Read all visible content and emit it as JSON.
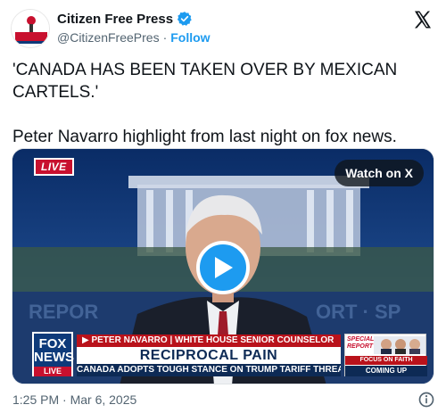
{
  "account": {
    "display_name": "Citizen Free Press",
    "handle": "@CitizenFreePres",
    "separator": "·",
    "follow_label": "Follow"
  },
  "tweet": {
    "text": "'CANADA HAS BEEN TAKEN OVER BY MEXICAN CARTELS.'\n\nPeter Navarro highlight from last night on fox news."
  },
  "media": {
    "live_badge": "LIVE",
    "watch_label": "Watch on X",
    "chyron": {
      "network": "FOX",
      "network_sub": "NEWS",
      "network_live": "LIVE",
      "nameplate": "▶ PETER NAVARRO | WHITE HOUSE SENIOR COUNSELOR",
      "headline": "RECIPROCAL PAIN",
      "subline": "CANADA ADOPTS TOUGH STANCE ON TRUMP TARIFF THREATS",
      "special_report": "SPECIAL REPORT",
      "focus": "FOCUS ON FAITH",
      "coming_up": "COMING UP"
    }
  },
  "footer": {
    "timestamp": "1:25 PM · Mar 6, 2025"
  },
  "colors": {
    "link_blue": "#1d9bf0",
    "text_primary": "#0f1419",
    "text_secondary": "#536471",
    "fox_red": "#b9121b",
    "fox_navy": "#0d2a55"
  },
  "icons": {
    "verified": "verified-badge-icon",
    "x_logo": "x-logo-icon",
    "play": "play-icon",
    "info": "info-icon"
  }
}
